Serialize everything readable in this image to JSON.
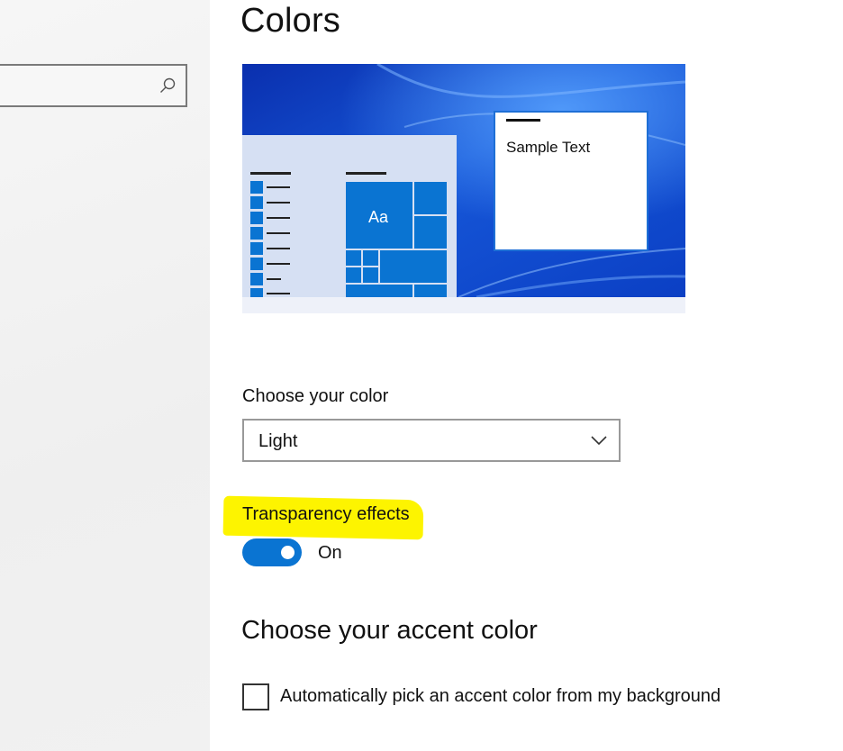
{
  "search": {
    "placeholder": "",
    "icon": "search-icon"
  },
  "page": {
    "title": "Colors"
  },
  "preview": {
    "sample_text": "Sample Text",
    "tile_label": "Aa",
    "colors": {
      "accent": "#0a74d2",
      "wallpaper": "#0f45c9",
      "start_pane": "#d6e0f3"
    }
  },
  "color_mode": {
    "label": "Choose your color",
    "selected": "Light",
    "icon": "chevron-down-icon"
  },
  "transparency": {
    "label": "Transparency effects",
    "state_label": "On",
    "enabled": true,
    "highlight_color": "#fdf400"
  },
  "accent": {
    "heading": "Choose your accent color",
    "auto_pick_label": "Automatically pick an accent color from my background",
    "auto_pick_checked": false
  }
}
